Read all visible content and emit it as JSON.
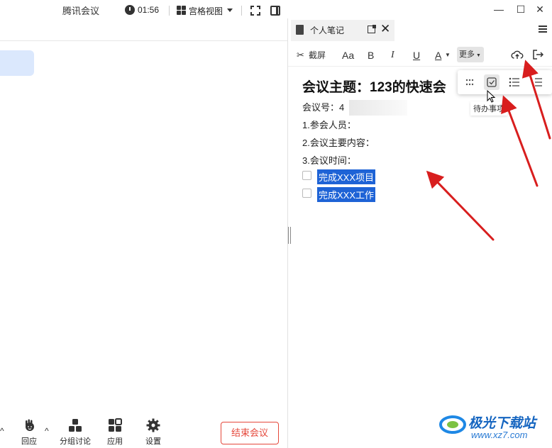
{
  "window": {
    "title": "腾讯会议"
  },
  "meeting": {
    "timer": "01:56",
    "view_mode": "宫格视图",
    "bottom_toolbar": [
      {
        "label": "回应",
        "icon": "raise-hand-icon"
      },
      {
        "label": "分组讨论",
        "icon": "breakout-rooms-icon"
      },
      {
        "label": "应用",
        "icon": "apps-icon"
      },
      {
        "label": "设置",
        "icon": "settings-gear-icon"
      }
    ],
    "end_button": "结束会议"
  },
  "notes": {
    "tab_title": "个人笔记",
    "toolbar": {
      "screenshot": "截屏",
      "font_size": "Aa",
      "bold": "B",
      "italic": "I",
      "underline": "U",
      "font_color": "A",
      "more": "更多"
    },
    "more_menu_tooltip": "待办事项",
    "heading": "会议主题：123的快速会",
    "meeting_id_label": "会议号：4",
    "lines": [
      "1.参会人员：",
      "2.会议主要内容：",
      "3.会议时间："
    ],
    "todos": [
      "完成XXX项目",
      "完成XXX工作"
    ]
  },
  "colors": {
    "accent_blue": "#1e63d6",
    "end_red": "#e5483b",
    "arrow_red": "#d81e1e",
    "video_tile": "#dbe8fd"
  },
  "watermark": {
    "name": "极光下载站",
    "url": "www.xz7.com"
  }
}
